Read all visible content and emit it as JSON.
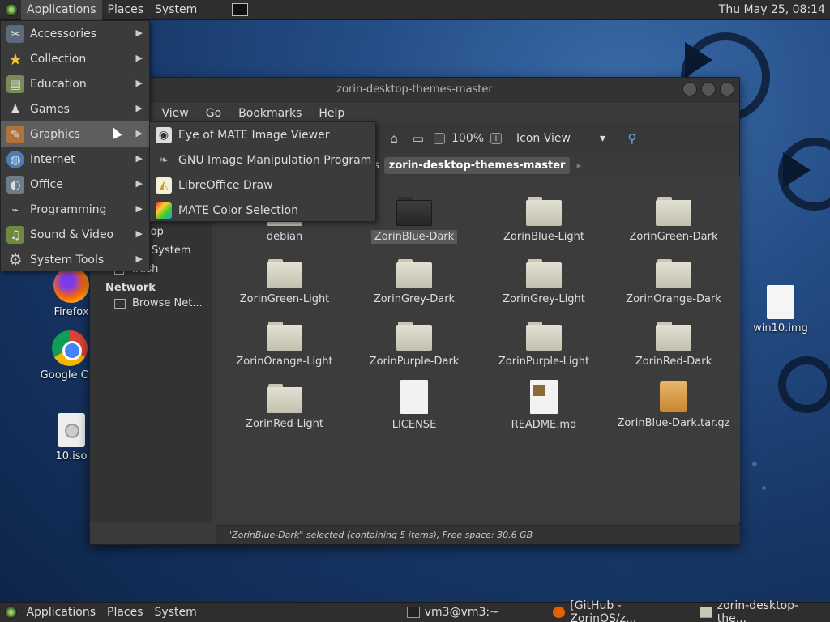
{
  "top_panel": {
    "menus": [
      "Applications",
      "Places",
      "System"
    ],
    "clock": "Thu May 25, 08:14"
  },
  "app_menu": {
    "items": [
      {
        "label": "Accessories",
        "icon": "accessories-icon"
      },
      {
        "label": "Collection",
        "icon": "star-icon"
      },
      {
        "label": "Education",
        "icon": "education-icon"
      },
      {
        "label": "Games",
        "icon": "games-icon"
      },
      {
        "label": "Graphics",
        "icon": "graphics-icon"
      },
      {
        "label": "Internet",
        "icon": "globe-icon"
      },
      {
        "label": "Office",
        "icon": "office-icon"
      },
      {
        "label": "Programming",
        "icon": "programming-icon"
      },
      {
        "label": "Sound & Video",
        "icon": "sound-video-icon"
      },
      {
        "label": "System Tools",
        "icon": "gear-icon"
      }
    ],
    "highlighted": "Graphics"
  },
  "graphics_submenu": {
    "items": [
      {
        "label": "Eye of MATE Image Viewer",
        "icon": "image-viewer-icon"
      },
      {
        "label": "GNU Image Manipulation Program",
        "icon": "gimp-icon"
      },
      {
        "label": "LibreOffice Draw",
        "icon": "libreoffice-draw-icon"
      },
      {
        "label": "MATE Color Selection",
        "icon": "color-selection-icon"
      }
    ]
  },
  "window": {
    "title": "zorin-desktop-themes-master",
    "menubar": [
      "t",
      "View",
      "Go",
      "Bookmarks",
      "Help"
    ],
    "toolbar": {
      "zoom": "100%",
      "view_mode": "Icon View"
    },
    "path_prefix": "s",
    "path_current": "zorin-desktop-themes-master",
    "sidebar": {
      "items_top": [
        "ktop",
        "System",
        "Trash"
      ],
      "network_heading": "Network",
      "network_items": [
        "Browse Net..."
      ]
    },
    "files": [
      {
        "name": "debian",
        "type": "folder"
      },
      {
        "name": "ZorinBlue-Dark",
        "type": "folder-dark",
        "selected": true
      },
      {
        "name": "ZorinBlue-Light",
        "type": "folder"
      },
      {
        "name": "ZorinGreen-Dark",
        "type": "folder"
      },
      {
        "name": "ZorinGreen-Light",
        "type": "folder"
      },
      {
        "name": "ZorinGrey-Dark",
        "type": "folder"
      },
      {
        "name": "ZorinGrey-Light",
        "type": "folder"
      },
      {
        "name": "ZorinOrange-Dark",
        "type": "folder"
      },
      {
        "name": "ZorinOrange-Light",
        "type": "folder"
      },
      {
        "name": "ZorinPurple-Dark",
        "type": "folder"
      },
      {
        "name": "ZorinPurple-Light",
        "type": "folder"
      },
      {
        "name": "ZorinRed-Dark",
        "type": "folder"
      },
      {
        "name": "ZorinRed-Light",
        "type": "folder"
      },
      {
        "name": "LICENSE",
        "type": "doc"
      },
      {
        "name": "README.md",
        "type": "readme"
      },
      {
        "name": "ZorinBlue-Dark.tar.gz",
        "type": "archive"
      }
    ],
    "status": "\"ZorinBlue-Dark\" selected (containing 5 items), Free space: 30.6 GB"
  },
  "desktop_icons": [
    {
      "label": "Firefox",
      "icon": "firefox-icon"
    },
    {
      "label": "Google Chr",
      "icon": "chrome-icon"
    },
    {
      "label": "10.iso",
      "icon": "disc-image-icon"
    },
    {
      "label": "win10.img",
      "icon": "file-icon"
    }
  ],
  "bottom_panel": {
    "menus": [
      "Applications",
      "Places",
      "System"
    ],
    "tasks": [
      {
        "label": "vm3@vm3:~",
        "icon": "terminal-icon"
      },
      {
        "label": "[GitHub - ZorinOS/z...",
        "icon": "firefox-icon"
      },
      {
        "label": "zorin-desktop-the...",
        "icon": "folder-icon"
      }
    ]
  }
}
